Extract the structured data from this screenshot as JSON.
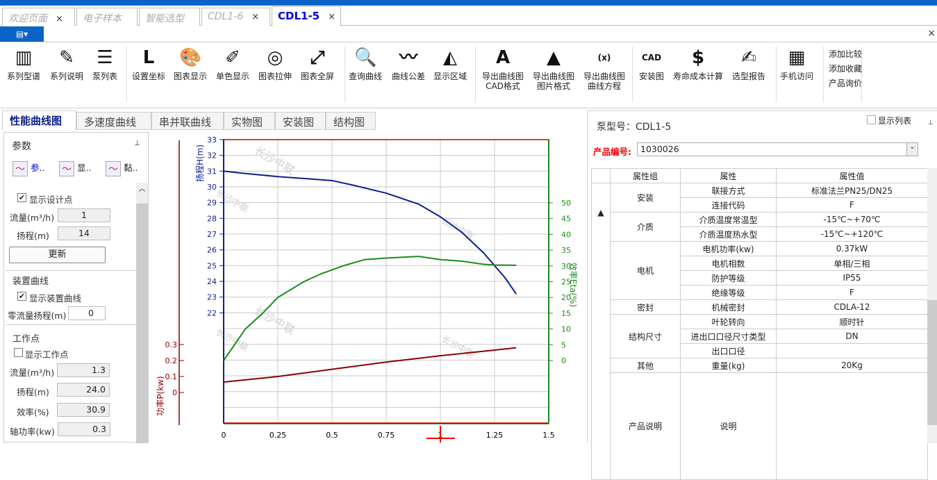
{
  "tabs": [
    {
      "label": "欢迎页面",
      "close": "×"
    },
    {
      "label": "电子样本"
    },
    {
      "label": "智能选型"
    },
    {
      "label": "CDL1-6",
      "close": "×"
    },
    {
      "label": "CDL1-5",
      "close": "×",
      "active": true
    }
  ],
  "menu_button": "▤▾",
  "ribbon_close": "×",
  "ribbon": [
    {
      "label": "系列型谱",
      "icon": "spectrum-icon",
      "glyph": "▥"
    },
    {
      "label": "系列说明",
      "icon": "edit-circle-icon",
      "glyph": "✎"
    },
    {
      "label": "泵列表",
      "icon": "list-icon",
      "glyph": "☰"
    },
    {
      "label": "设置坐标",
      "icon": "axis-icon",
      "glyph": "L"
    },
    {
      "label": "图表显示",
      "icon": "palette-icon",
      "glyph": "🎨"
    },
    {
      "label": "单色显示",
      "icon": "mono-palette-icon",
      "glyph": "✐"
    },
    {
      "label": "图表拉伸",
      "icon": "stretch-icon",
      "glyph": "◎"
    },
    {
      "label": "图表全屏",
      "icon": "fullscreen-icon",
      "glyph": "⤢"
    },
    {
      "label": "查询曲线",
      "icon": "search-curve-icon",
      "glyph": "🔍"
    },
    {
      "label": "曲线公差",
      "icon": "curve-tolerance-icon",
      "glyph": "〰"
    },
    {
      "label": "显示区域",
      "icon": "area-icon",
      "glyph": "◭"
    },
    {
      "label": "导出曲线图",
      "label2": "CAD格式",
      "icon": "export-cad-icon",
      "glyph": "A"
    },
    {
      "label": "导出曲线图",
      "label2": "图片格式",
      "icon": "export-image-icon",
      "glyph": "▲"
    },
    {
      "label": "导出曲线图",
      "label2": "曲线方程",
      "icon": "equation-icon",
      "glyph": "(x)"
    },
    {
      "label": "安装图",
      "icon": "cad-file-icon",
      "glyph": "CAD"
    },
    {
      "label": "寿命成本计算",
      "icon": "money-bag-icon",
      "glyph": "$"
    },
    {
      "label": "选型报告",
      "icon": "report-icon",
      "glyph": "✍"
    },
    {
      "label": "手机访问",
      "icon": "phone-icon",
      "glyph": "▦"
    }
  ],
  "ribbon_small": [
    "添加比较",
    "添加收藏",
    "产品询价"
  ],
  "chart_tabs": [
    "性能曲线图",
    "多速度曲线",
    "串并联曲线",
    "实物图",
    "安装图",
    "结构图"
  ],
  "left_panel": {
    "title": "参数",
    "pin": "⊥",
    "tools": [
      "参..",
      "显..",
      "黏.."
    ],
    "design": {
      "show_label": "显示设计点",
      "show": true,
      "flow_label": "流量(m³/h)",
      "flow": "1",
      "head_label": "扬程(m)",
      "head": "14",
      "update": "更新"
    },
    "device": {
      "title": "装置曲线",
      "show_label": "显示装置曲线",
      "show": true,
      "zero_label": "零流量扬程(m)",
      "zero": "0"
    },
    "work": {
      "title": "工作点",
      "show_label": "显示工作点",
      "show": false,
      "flow_label": "流量(m³/h)",
      "flow": "1.3",
      "head_label": "扬程(m)",
      "head": "24.0",
      "eff_label": "效率(%)",
      "eff": "30.9",
      "power_label": "轴功率(kw)",
      "power": "0.3"
    }
  },
  "chart_data": {
    "type": "line",
    "watermark": "长沙中联",
    "x_ticks": [
      "0",
      "0.25",
      "0.5",
      "0.75",
      "1",
      "1.25",
      "1.5"
    ],
    "xlim": [
      0,
      1.5
    ],
    "grid": true,
    "axes": {
      "head": {
        "label": "扬程H(m)",
        "range": [
          22,
          33
        ],
        "color": "#0a1f8a"
      },
      "eff": {
        "label": "效率Eta(%)",
        "range": [
          0,
          50
        ],
        "color": "#1a8a1a"
      },
      "power": {
        "label": "功率P(kw)",
        "range": [
          0,
          0.3
        ],
        "color": "#8b0000"
      }
    },
    "series": [
      {
        "axis": "head",
        "x": [
          0,
          0.1,
          0.25,
          0.4,
          0.5,
          0.6,
          0.75,
          0.9,
          1.0,
          1.1,
          1.2,
          1.25,
          1.3,
          1.35
        ],
        "y": [
          31,
          30.85,
          30.65,
          30.5,
          30.4,
          30.1,
          29.6,
          28.9,
          28.1,
          27.1,
          25.8,
          25.0,
          24.2,
          23.2
        ]
      },
      {
        "axis": "eff",
        "x": [
          0,
          0.05,
          0.1,
          0.18,
          0.25,
          0.37,
          0.45,
          0.55,
          0.65,
          0.75,
          0.9,
          1.0,
          1.1,
          1.2,
          1.25,
          1.35
        ],
        "y": [
          0,
          5,
          10,
          15,
          20,
          25,
          27.5,
          30,
          32,
          32.5,
          33,
          32,
          31.5,
          30.5,
          30.3,
          30.2
        ]
      },
      {
        "axis": "power",
        "x": [
          0,
          0.25,
          0.5,
          0.75,
          1.0,
          1.25,
          1.35
        ],
        "y": [
          0.065,
          0.1,
          0.145,
          0.19,
          0.23,
          0.265,
          0.28
        ]
      }
    ]
  },
  "right_panel": {
    "model_label": "泵型号：",
    "model": "CDL1-5",
    "show_list": "显示列表",
    "pin": "⊥",
    "code_label": "产品编号:",
    "code": "1030026",
    "headers": [
      "属性组",
      "属性",
      "属性值"
    ],
    "groups": [
      {
        "name": "安装",
        "rows": [
          [
            "联接方式",
            "标准法兰PN25/DN25"
          ],
          [
            "连接代码",
            "F"
          ]
        ]
      },
      {
        "name": "介质",
        "rows": [
          [
            "介质温度常温型",
            "-15℃~+70℃"
          ],
          [
            "介质温度热水型",
            "-15℃~+120℃"
          ]
        ]
      },
      {
        "name": "电机",
        "rows": [
          [
            "电机功率(kw)",
            "0.37kW"
          ],
          [
            "电机相数",
            "单相/三相"
          ],
          [
            "防护等级",
            "IP55"
          ],
          [
            "绝缘等级",
            "F"
          ]
        ]
      },
      {
        "name": "密封",
        "rows": [
          [
            "机械密封",
            "CDLA-12"
          ]
        ]
      },
      {
        "name": "结构尺寸",
        "rows": [
          [
            "叶轮转向",
            "顺时针"
          ],
          [
            "进出口口径尺寸类型",
            "DN"
          ],
          [
            "出口口径",
            ""
          ]
        ]
      },
      {
        "name": "其他",
        "rows": [
          [
            "重量(kg)",
            "20Kg"
          ]
        ]
      },
      {
        "name": "产品说明",
        "rows": [
          [
            "说明",
            ""
          ]
        ],
        "tall": true
      }
    ]
  }
}
